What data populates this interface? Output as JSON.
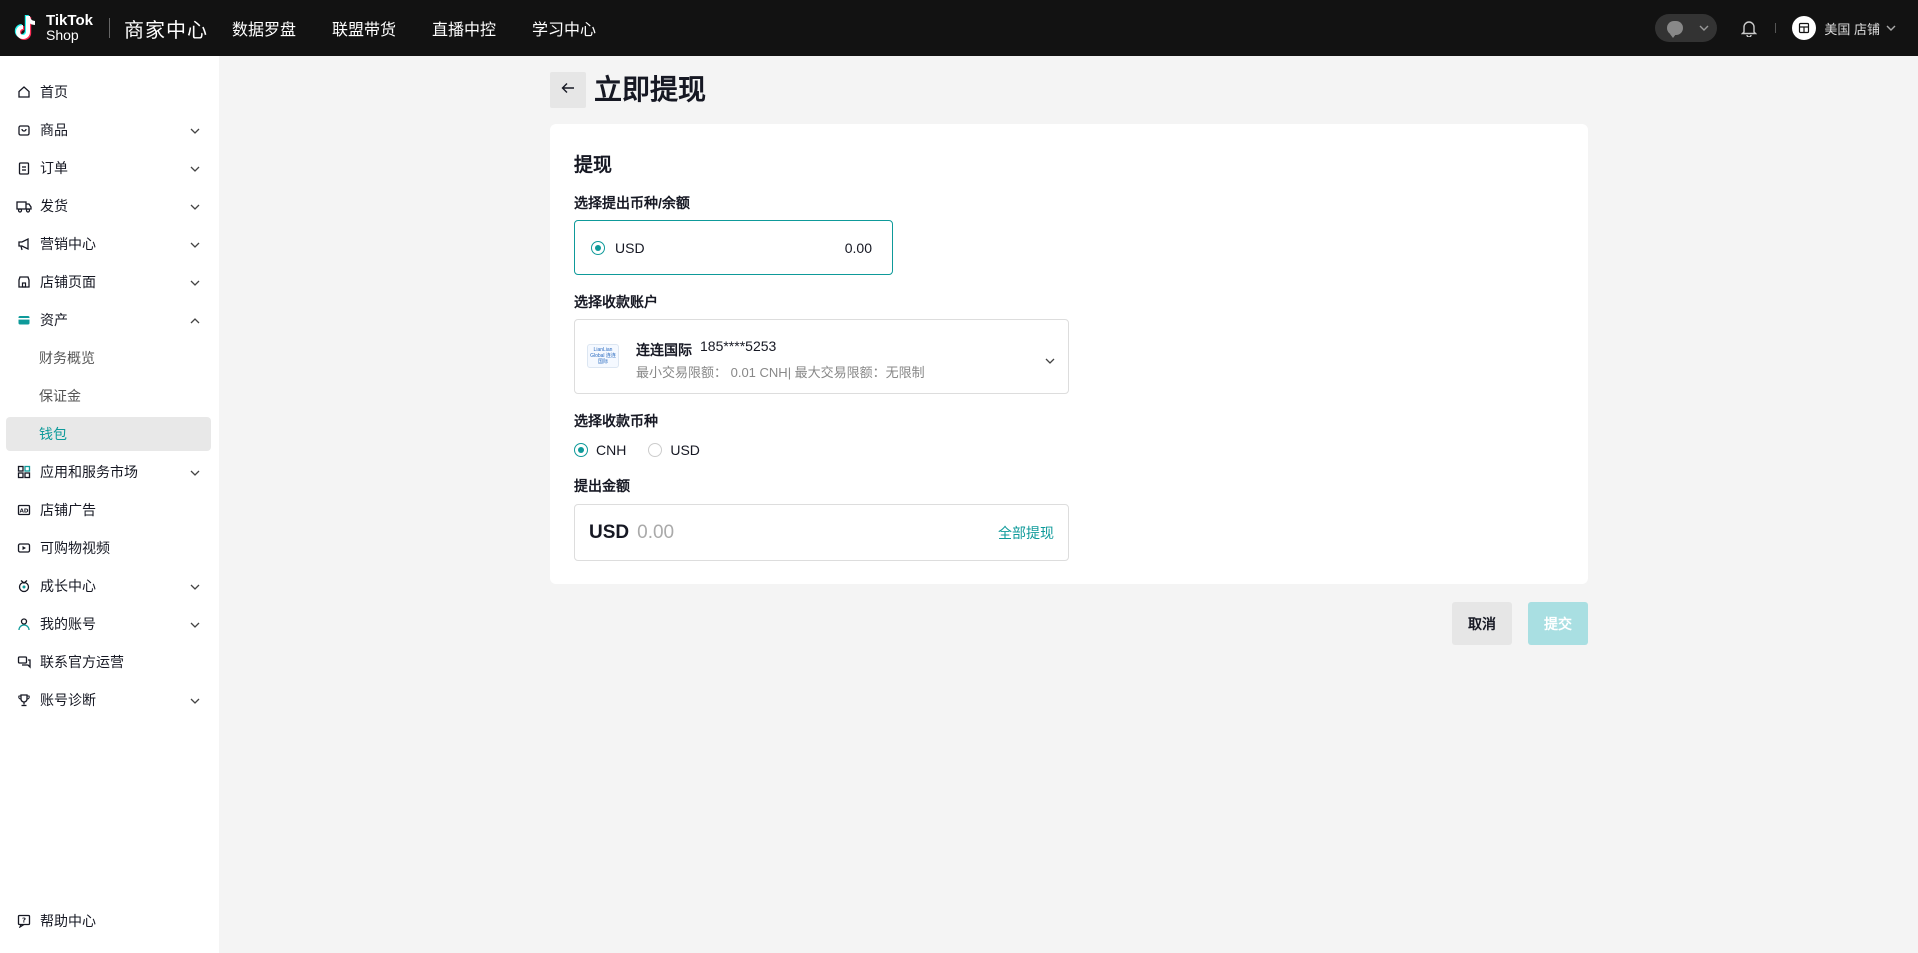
{
  "topbar": {
    "logo_line1": "TikTok",
    "logo_line2": "Shop",
    "brand_title": "商家中心",
    "nav": [
      "数据罗盘",
      "联盟带货",
      "直播中控",
      "学习中心"
    ],
    "store_name": "美国 店铺"
  },
  "sidebar": {
    "items": [
      {
        "label": "首页",
        "icon": "home-icon"
      },
      {
        "label": "商品",
        "icon": "product-icon"
      },
      {
        "label": "订单",
        "icon": "order-icon"
      },
      {
        "label": "发货",
        "icon": "truck-icon"
      },
      {
        "label": "营销中心",
        "icon": "megaphone-icon"
      },
      {
        "label": "店铺页面",
        "icon": "store-icon"
      },
      {
        "label": "资产",
        "icon": "wallet-icon"
      },
      {
        "label": "财务概览"
      },
      {
        "label": "保证金"
      },
      {
        "label": "钱包"
      },
      {
        "label": "应用和服务市场",
        "icon": "apps-icon"
      },
      {
        "label": "店铺广告",
        "icon": "ad-icon"
      },
      {
        "label": "可购物视频",
        "icon": "video-icon"
      },
      {
        "label": "成长中心",
        "icon": "medal-icon"
      },
      {
        "label": "我的账号",
        "icon": "user-icon"
      },
      {
        "label": "联系官方运营",
        "icon": "chat-icon"
      },
      {
        "label": "账号诊断",
        "icon": "trophy-icon"
      }
    ],
    "help": "帮助中心"
  },
  "page": {
    "title": "立即提现"
  },
  "card": {
    "title": "提现",
    "currency_label": "选择提出币种/余额",
    "balance_currency": "USD",
    "balance_amount": "0.00",
    "account_label": "选择收款账户",
    "account_logo_text": "LianLian Global 连连国际",
    "account_name": "连连国际",
    "account_number": "185****5253",
    "account_limits": "最小交易限额： 0.01 CNH| 最大交易限额：无限制",
    "receive_currency_label": "选择收款币种",
    "receive_options": [
      "CNH",
      "USD"
    ],
    "receive_selected": "CNH",
    "amount_label": "提出金额",
    "amount_currency": "USD",
    "amount_placeholder": "0.00",
    "withdraw_all": "全部提现"
  },
  "actions": {
    "cancel": "取消",
    "submit": "提交"
  },
  "colors": {
    "accent": "#0e9a9a",
    "topbar": "#121212",
    "submit_disabled": "#a9dfe2"
  }
}
